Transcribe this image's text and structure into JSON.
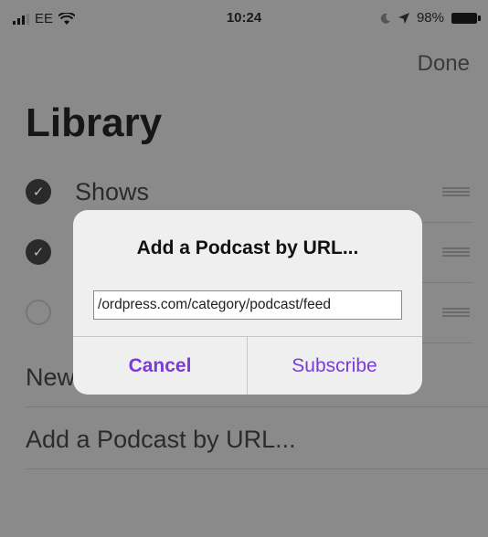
{
  "status_bar": {
    "carrier": "EE",
    "time": "10:24",
    "battery": "98%"
  },
  "nav": {
    "done_label": "Done"
  },
  "page_title": "Library",
  "library_items": [
    {
      "label": "Shows",
      "checked": true
    },
    {
      "label": "",
      "checked": true
    },
    {
      "label": "",
      "checked": false
    }
  ],
  "list_rows": [
    {
      "label": "New"
    },
    {
      "label": "Add a Podcast by URL..."
    }
  ],
  "dialog": {
    "title": "Add a Podcast by URL...",
    "input_value": "ordpress.com/category/podcast/feed/",
    "cancel_label": "Cancel",
    "subscribe_label": "Subscribe"
  },
  "colors": {
    "accent": "#7a3bd6",
    "dim_background": "#8a8a8a"
  }
}
